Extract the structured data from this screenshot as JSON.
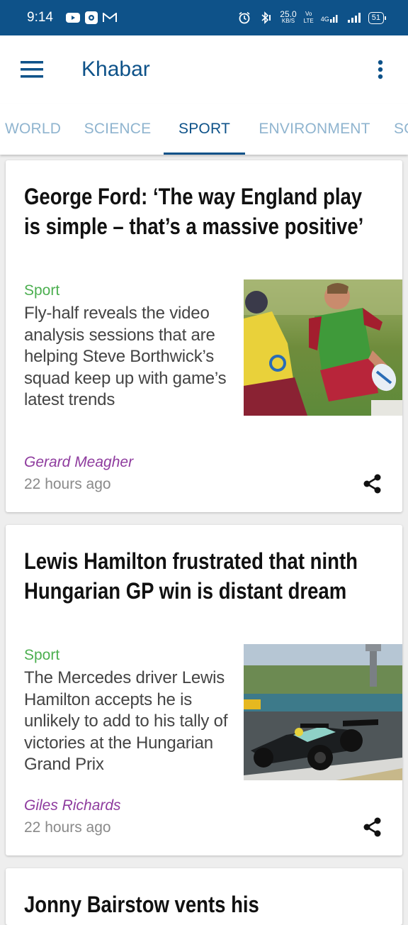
{
  "status": {
    "time": "9:14",
    "speed_value": "25.0",
    "speed_unit": "KB/S",
    "volte_top": "Vo",
    "volte_bottom": "LTE",
    "network": "4G",
    "battery": "51"
  },
  "app": {
    "title": "Khabar"
  },
  "tabs": [
    {
      "label": "WORLD"
    },
    {
      "label": "SCIENCE"
    },
    {
      "label": "SPORT",
      "active": true
    },
    {
      "label": "ENVIRONMENT"
    },
    {
      "label": "SO"
    }
  ],
  "articles": [
    {
      "title": "George Ford: ‘The way England play is simple – that’s a massive positive’",
      "section": "Sport",
      "trail": "Fly-half reveals the video analysis sessions that are helping Steve Borthwick’s squad keep up with game’s latest trends",
      "byline": "Gerard Meagher",
      "time": "22 hours ago",
      "image_icon": "rugby-photo"
    },
    {
      "title": "Lewis Hamilton frustrated that ninth Hungarian GP win is distant dream",
      "section": "Sport",
      "trail": "The Mercedes driver Lewis Hamilton accepts he is unlikely to add to his tally of victories at the Hungarian Grand Prix",
      "byline": "Giles Richards",
      "time": "22 hours ago",
      "image_icon": "f1-car-photo"
    },
    {
      "title": "Jonny Bairstow vents his"
    }
  ],
  "colors": {
    "primary": "#0e5289",
    "tab_inactive": "#8fb4cf",
    "section": "#4caf50",
    "byline": "#8e3b9e"
  }
}
